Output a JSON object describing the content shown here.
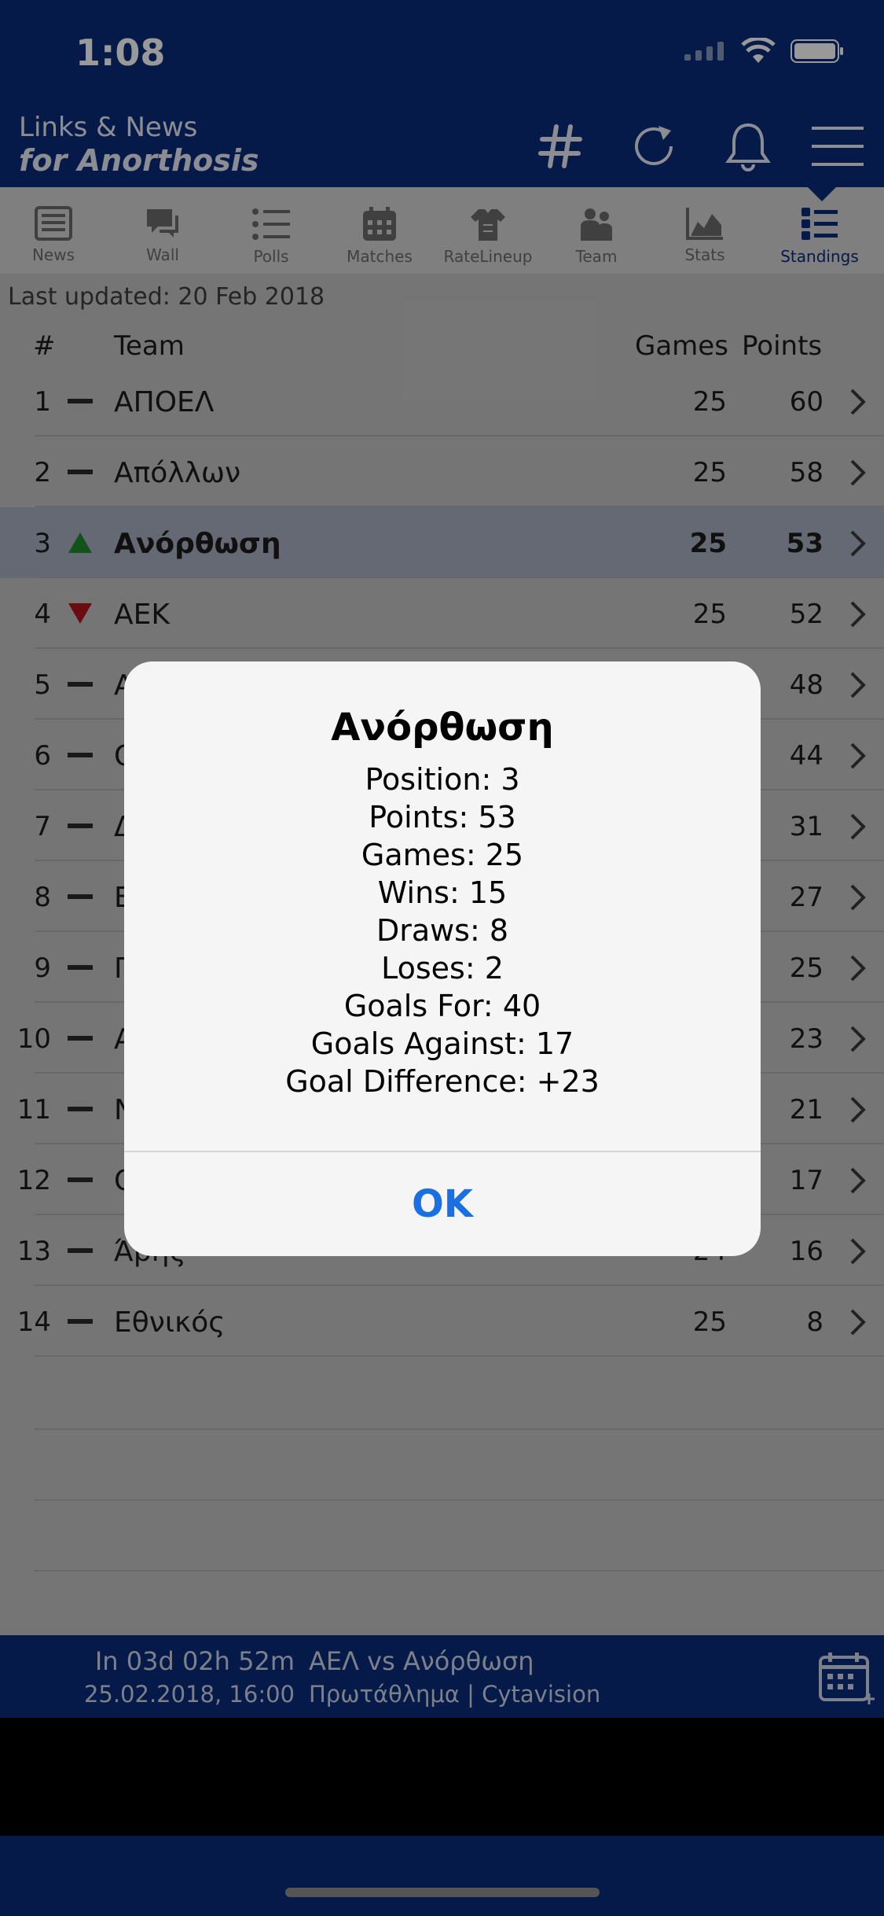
{
  "status_bar": {
    "time": "1:08"
  },
  "header": {
    "brand_line1": "Links & News",
    "brand_line2": "for Anorthosis"
  },
  "tabs": [
    {
      "label": "News",
      "icon": "news-icon",
      "active": false
    },
    {
      "label": "Wall",
      "icon": "wall-icon",
      "active": false
    },
    {
      "label": "Polls",
      "icon": "polls-icon",
      "active": false
    },
    {
      "label": "Matches",
      "icon": "calendar-icon",
      "active": false
    },
    {
      "label": "RateLineup",
      "icon": "lineup-icon",
      "active": false
    },
    {
      "label": "Team",
      "icon": "team-icon",
      "active": false
    },
    {
      "label": "Stats",
      "icon": "stats-icon",
      "active": false
    },
    {
      "label": "Standings",
      "icon": "standings-icon",
      "active": true
    }
  ],
  "last_updated": "Last updated: 20 Feb 2018",
  "table": {
    "headers": {
      "pos": "#",
      "team": "Team",
      "games": "Games",
      "points": "Points"
    },
    "rows": [
      {
        "pos": "1",
        "trend": "same",
        "team": "ΑΠΟΕΛ",
        "games": "25",
        "points": "60"
      },
      {
        "pos": "2",
        "trend": "same",
        "team": "Απόλλων",
        "games": "25",
        "points": "58"
      },
      {
        "pos": "3",
        "trend": "up",
        "team": "Ανόρθωση",
        "games": "25",
        "points": "53",
        "highlight": true
      },
      {
        "pos": "4",
        "trend": "down",
        "team": "ΑΕΚ",
        "games": "25",
        "points": "52"
      },
      {
        "pos": "5",
        "trend": "same",
        "team": "Α",
        "games": "",
        "points": "48"
      },
      {
        "pos": "6",
        "trend": "same",
        "team": "Ο",
        "games": "",
        "points": "44"
      },
      {
        "pos": "7",
        "trend": "same",
        "team": "Δ",
        "games": "",
        "points": "31"
      },
      {
        "pos": "8",
        "trend": "same",
        "team": "Ε",
        "games": "",
        "points": "27"
      },
      {
        "pos": "9",
        "trend": "same",
        "team": "Π",
        "games": "",
        "points": "25"
      },
      {
        "pos": "10",
        "trend": "same",
        "team": "Α",
        "games": "",
        "points": "23"
      },
      {
        "pos": "11",
        "trend": "same",
        "team": "Ν",
        "games": "",
        "points": "21"
      },
      {
        "pos": "12",
        "trend": "same",
        "team": "Ο",
        "games": "",
        "points": "17"
      },
      {
        "pos": "13",
        "trend": "same",
        "team": "Άρης",
        "games": "24",
        "points": "16"
      },
      {
        "pos": "14",
        "trend": "same",
        "team": "Εθνικός",
        "games": "25",
        "points": "8"
      }
    ]
  },
  "footer": {
    "countdown": "In 03d 02h 52m",
    "datetime": "25.02.2018, 16:00",
    "match": "ΑΕΛ vs Ανόρθωση",
    "competition": "Πρωτάθλημα | Cytavision"
  },
  "dialog": {
    "title": "Ανόρθωση",
    "lines": [
      "Position: 3",
      "Points: 53",
      "Games: 25",
      "Wins: 15",
      "Draws: 8",
      "Loses: 2",
      "Goals For: 40",
      "Goals Against: 17",
      "Goal Difference: +23"
    ],
    "ok_label": "OK"
  },
  "colors": {
    "brand_navy": "#0a2c7a",
    "trend_up": "#1e8a2a",
    "trend_down": "#b3141c",
    "ok_blue": "#1a6fe3"
  }
}
